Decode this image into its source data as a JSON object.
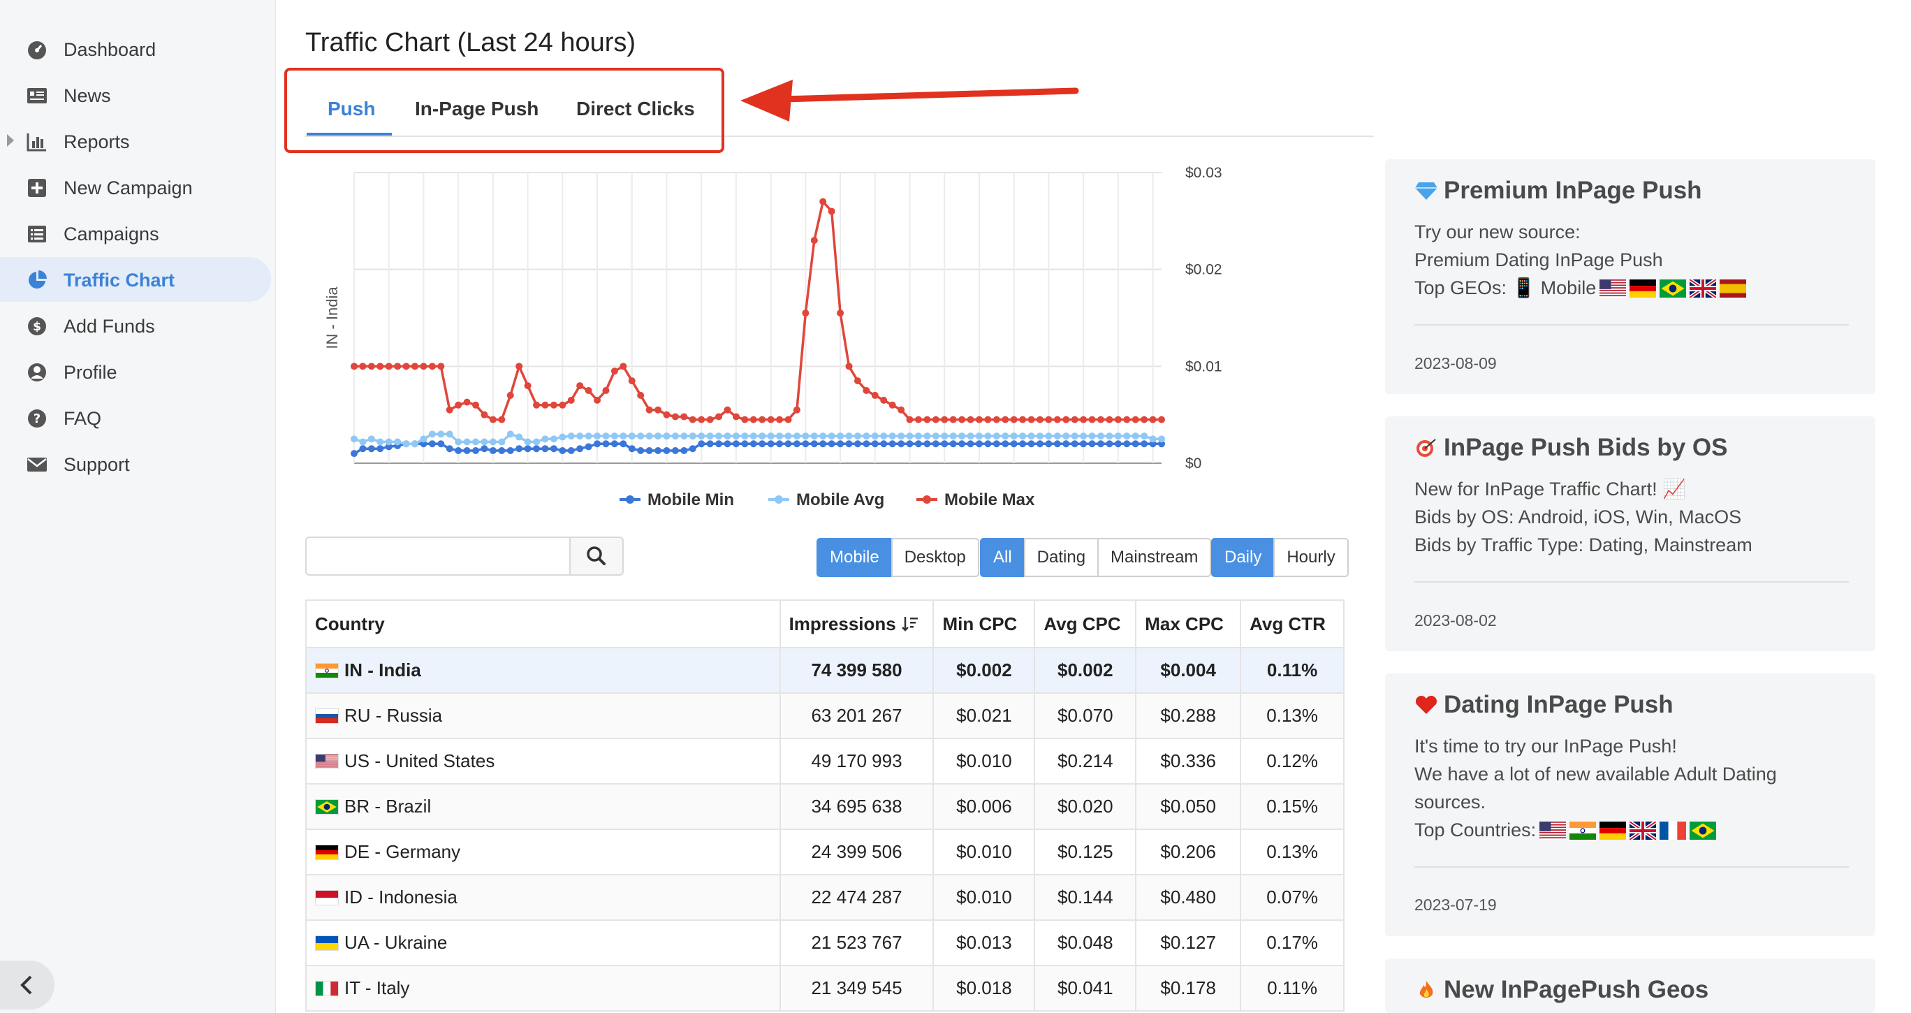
{
  "sidebar": {
    "items": [
      {
        "label": "Dashboard",
        "icon": "dashboard-icon"
      },
      {
        "label": "News",
        "icon": "news-icon"
      },
      {
        "label": "Reports",
        "icon": "reports-icon"
      },
      {
        "label": "New Campaign",
        "icon": "plus-square-icon"
      },
      {
        "label": "Campaigns",
        "icon": "list-icon"
      },
      {
        "label": "Traffic Chart",
        "icon": "pie-chart-icon"
      },
      {
        "label": "Add Funds",
        "icon": "dollar-icon"
      },
      {
        "label": "Profile",
        "icon": "user-icon"
      },
      {
        "label": "FAQ",
        "icon": "question-icon"
      },
      {
        "label": "Support",
        "icon": "envelope-icon"
      }
    ],
    "active": "Traffic Chart"
  },
  "page": {
    "title": "Traffic Chart (Last 24 hours)"
  },
  "tabs": [
    {
      "label": "Push",
      "active": true
    },
    {
      "label": "In-Page Push",
      "active": false
    },
    {
      "label": "Direct Clicks",
      "active": false
    }
  ],
  "chart_data": {
    "type": "line",
    "ylabel": "IN - India",
    "right_ticks": [
      "$0.03",
      "$0.02",
      "$0.01",
      "$0"
    ],
    "ylim": [
      0,
      0.03
    ],
    "grid": true,
    "legend_position": "bottom-center",
    "series": [
      {
        "name": "Mobile Min",
        "color": "#3b76d8",
        "values": [
          0.001,
          0.0015,
          0.0015,
          0.0015,
          0.0017,
          0.0018,
          0.002,
          0.002,
          0.002,
          0.002,
          0.002,
          0.0015,
          0.0013,
          0.0013,
          0.0013,
          0.0015,
          0.0013,
          0.0013,
          0.0013,
          0.0015,
          0.0015,
          0.0015,
          0.0015,
          0.0015,
          0.0013,
          0.0013,
          0.0015,
          0.0017,
          0.002,
          0.002,
          0.002,
          0.002,
          0.0015,
          0.0013,
          0.0013,
          0.0013,
          0.0013,
          0.0013,
          0.0013,
          0.0015,
          0.002,
          0.002,
          0.002,
          0.002,
          0.002,
          0.002,
          0.002,
          0.002,
          0.002,
          0.002,
          0.002,
          0.002,
          0.002,
          0.002,
          0.002,
          0.002,
          0.002,
          0.002,
          0.002,
          0.002,
          0.002,
          0.002,
          0.002,
          0.002,
          0.002,
          0.002,
          0.002,
          0.002,
          0.002,
          0.002,
          0.002,
          0.002,
          0.002,
          0.002,
          0.002,
          0.002,
          0.002,
          0.002,
          0.002,
          0.002,
          0.002,
          0.002,
          0.002,
          0.002,
          0.002,
          0.002,
          0.002,
          0.002,
          0.002,
          0.002,
          0.002,
          0.002,
          0.002,
          0.002
        ]
      },
      {
        "name": "Mobile Avg",
        "color": "#90c8f5",
        "values": [
          0.0025,
          0.0022,
          0.0025,
          0.0022,
          0.0022,
          0.0022,
          0.002,
          0.002,
          0.0025,
          0.003,
          0.003,
          0.003,
          0.0022,
          0.0022,
          0.0022,
          0.0022,
          0.0022,
          0.0022,
          0.003,
          0.0027,
          0.0022,
          0.0022,
          0.0025,
          0.0025,
          0.0027,
          0.0028,
          0.0028,
          0.0028,
          0.0028,
          0.0028,
          0.0028,
          0.0028,
          0.0028,
          0.0028,
          0.0028,
          0.0028,
          0.0028,
          0.0028,
          0.0028,
          0.0028,
          0.0028,
          0.0028,
          0.0028,
          0.0028,
          0.0028,
          0.0028,
          0.0028,
          0.0028,
          0.0028,
          0.0028,
          0.0028,
          0.0028,
          0.0028,
          0.0028,
          0.0028,
          0.0028,
          0.0028,
          0.0028,
          0.0028,
          0.0028,
          0.0028,
          0.0028,
          0.0028,
          0.0028,
          0.0028,
          0.0028,
          0.0028,
          0.0028,
          0.0028,
          0.0028,
          0.0028,
          0.0028,
          0.0028,
          0.0028,
          0.0028,
          0.0028,
          0.0028,
          0.0028,
          0.0028,
          0.0028,
          0.0028,
          0.0028,
          0.0028,
          0.0028,
          0.0028,
          0.0028,
          0.0028,
          0.0028,
          0.0028,
          0.0028,
          0.0028,
          0.0028,
          0.0025,
          0.0025
        ]
      },
      {
        "name": "Mobile Max",
        "color": "#e0463a",
        "values": [
          0.01,
          0.01,
          0.01,
          0.01,
          0.01,
          0.01,
          0.01,
          0.01,
          0.01,
          0.01,
          0.01,
          0.0055,
          0.006,
          0.0063,
          0.006,
          0.005,
          0.0045,
          0.0045,
          0.007,
          0.01,
          0.008,
          0.006,
          0.006,
          0.006,
          0.006,
          0.0065,
          0.008,
          0.0075,
          0.0065,
          0.0075,
          0.0095,
          0.01,
          0.0085,
          0.007,
          0.0055,
          0.0055,
          0.005,
          0.0048,
          0.0048,
          0.0045,
          0.0045,
          0.0045,
          0.0048,
          0.0055,
          0.0048,
          0.0045,
          0.0045,
          0.0045,
          0.0045,
          0.0045,
          0.0045,
          0.0055,
          0.0155,
          0.023,
          0.027,
          0.026,
          0.0155,
          0.01,
          0.0085,
          0.0075,
          0.007,
          0.0065,
          0.006,
          0.0055,
          0.0045,
          0.0045,
          0.0045,
          0.0045,
          0.0045,
          0.0045,
          0.0045,
          0.0045,
          0.0045,
          0.0045,
          0.0045,
          0.0045,
          0.0045,
          0.0045,
          0.0045,
          0.0045,
          0.0045,
          0.0045,
          0.0045,
          0.0045,
          0.0045,
          0.0045,
          0.0045,
          0.0045,
          0.0045,
          0.0045,
          0.0045,
          0.0045,
          0.0045,
          0.0045
        ]
      }
    ]
  },
  "controls": {
    "search_placeholder": "",
    "device": [
      "Mobile",
      "Desktop"
    ],
    "device_selected": "Mobile",
    "category": [
      "All",
      "Dating",
      "Mainstream"
    ],
    "category_selected": "All",
    "period": [
      "Daily",
      "Hourly"
    ],
    "period_selected": "Daily"
  },
  "table": {
    "headers": [
      "Country",
      "Impressions",
      "Min CPC",
      "Avg CPC",
      "Max CPC",
      "Avg CTR"
    ],
    "rows": [
      {
        "country": "IN - India",
        "flag": "in",
        "impressions": "74 399 580",
        "min": "$0.002",
        "avg": "$0.002",
        "max": "$0.004",
        "ctr": "0.11%",
        "selected": true
      },
      {
        "country": "RU - Russia",
        "flag": "ru",
        "impressions": "63 201 267",
        "min": "$0.021",
        "avg": "$0.070",
        "max": "$0.288",
        "ctr": "0.13%"
      },
      {
        "country": "US - United States",
        "flag": "us",
        "impressions": "49 170 993",
        "min": "$0.010",
        "avg": "$0.214",
        "max": "$0.336",
        "ctr": "0.12%"
      },
      {
        "country": "BR - Brazil",
        "flag": "br",
        "impressions": "34 695 638",
        "min": "$0.006",
        "avg": "$0.020",
        "max": "$0.050",
        "ctr": "0.15%"
      },
      {
        "country": "DE - Germany",
        "flag": "de",
        "impressions": "24 399 506",
        "min": "$0.010",
        "avg": "$0.125",
        "max": "$0.206",
        "ctr": "0.13%"
      },
      {
        "country": "ID - Indonesia",
        "flag": "id",
        "impressions": "22 474 287",
        "min": "$0.010",
        "avg": "$0.144",
        "max": "$0.480",
        "ctr": "0.07%"
      },
      {
        "country": "UA - Ukraine",
        "flag": "ua",
        "impressions": "21 523 767",
        "min": "$0.013",
        "avg": "$0.048",
        "max": "$0.127",
        "ctr": "0.17%"
      },
      {
        "country": "IT - Italy",
        "flag": "it",
        "impressions": "21 349 545",
        "min": "$0.018",
        "avg": "$0.041",
        "max": "$0.178",
        "ctr": "0.11%"
      }
    ]
  },
  "news": [
    {
      "icon": "gem-icon",
      "title": "Premium InPage Push",
      "lines": [
        "Try our new source:",
        "Premium Dating InPage Push",
        "Top GEOs: 📱 Mobile"
      ],
      "flags": [
        "us",
        "de",
        "br",
        "gb",
        "es"
      ],
      "date": "2023-08-09"
    },
    {
      "icon": "target-icon",
      "title": "InPage Push Bids by OS",
      "lines": [
        "New for InPage Traffic Chart! 📈",
        "Bids by OS: Android, iOS, Win, MacOS",
        "Bids by Traffic Type: Dating, Mainstream"
      ],
      "date": "2023-08-02"
    },
    {
      "icon": "heart-icon",
      "title": "Dating InPage Push",
      "lines": [
        "It's time to try our InPage Push!",
        "We have a lot of new available Adult Dating",
        "sources.",
        "Top Countries:"
      ],
      "flags": [
        "us",
        "in",
        "de",
        "gb",
        "fr",
        "br"
      ],
      "date": "2023-07-19"
    },
    {
      "icon": "fire-icon",
      "title": "New InPagePush Geos"
    }
  ]
}
